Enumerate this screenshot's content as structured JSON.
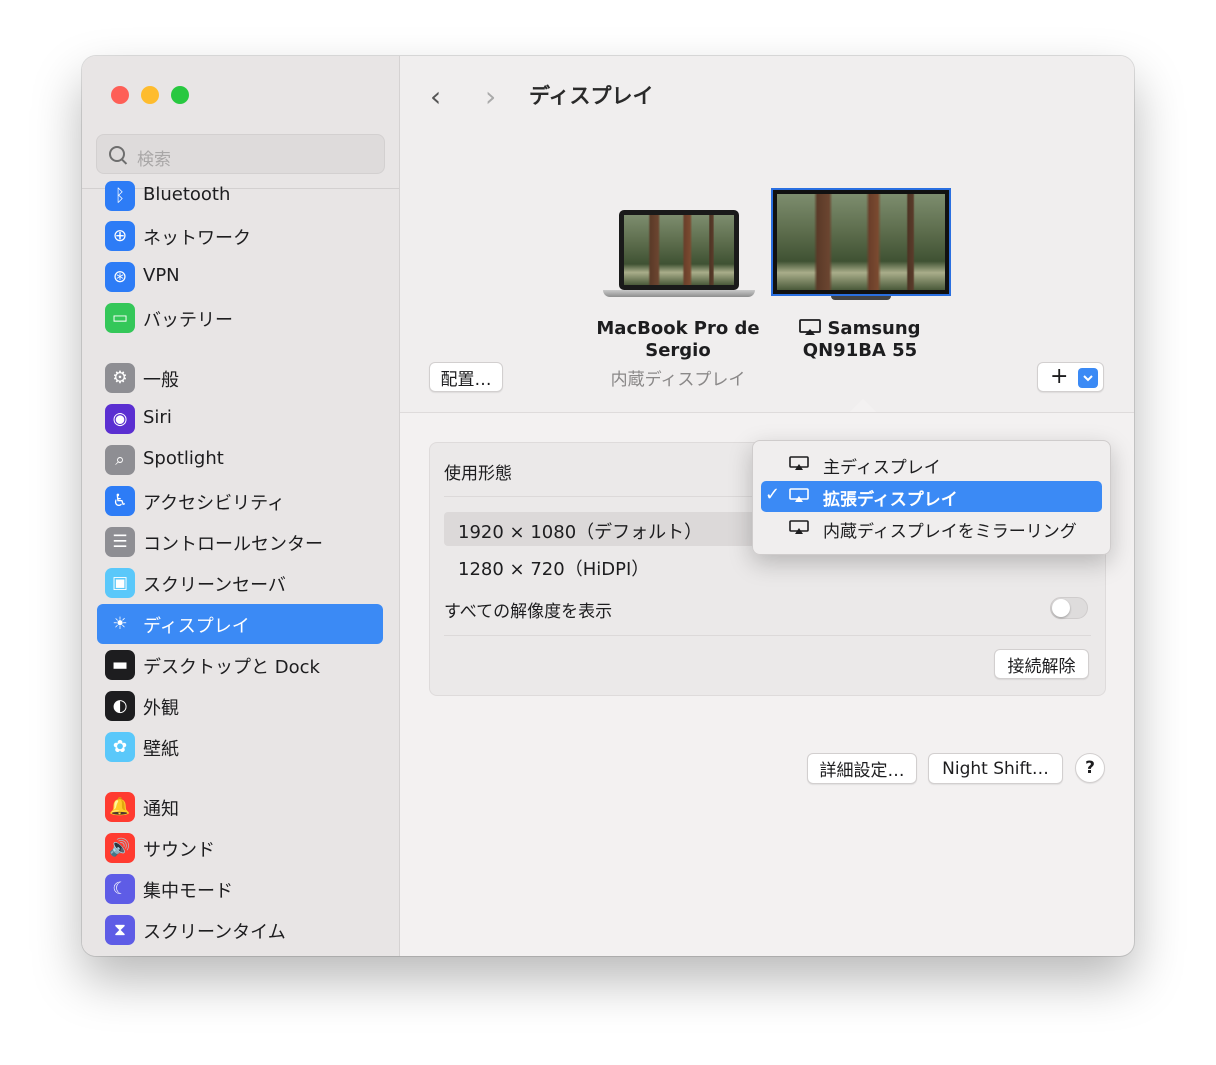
{
  "window": {
    "traffic_lights": [
      {
        "name": "close",
        "color": "#fe5f57"
      },
      {
        "name": "minimize",
        "color": "#febc2e"
      },
      {
        "name": "zoom",
        "color": "#28c840"
      }
    ]
  },
  "sidebar": {
    "search_placeholder": "検索",
    "items": [
      {
        "label": "Bluetooth",
        "icon": "bluetooth-icon",
        "color": "#2d7cf6",
        "glyph": "ᛒ"
      },
      {
        "label": "ネットワーク",
        "icon": "globe-icon",
        "color": "#2d7cf6",
        "glyph": "⊕"
      },
      {
        "label": "VPN",
        "icon": "vpn-globe-icon",
        "color": "#2d7cf6",
        "glyph": "⊛"
      },
      {
        "label": "バッテリー",
        "icon": "battery-icon",
        "color": "#34c759",
        "glyph": "▭"
      },
      {
        "label": "一般",
        "icon": "gear-icon",
        "color": "#8e8e93",
        "glyph": "⚙"
      },
      {
        "label": "Siri",
        "icon": "siri-icon",
        "color": "#5b2fd1",
        "glyph": "◉"
      },
      {
        "label": "Spotlight",
        "icon": "spotlight-icon",
        "color": "#8e8e93",
        "glyph": "⌕"
      },
      {
        "label": "アクセシビリティ",
        "icon": "accessibility-icon",
        "color": "#2d7cf6",
        "glyph": "♿"
      },
      {
        "label": "コントロールセンター",
        "icon": "control-center-icon",
        "color": "#8e8e93",
        "glyph": "☰"
      },
      {
        "label": "スクリーンセーバ",
        "icon": "screensaver-icon",
        "color": "#5ac8fa",
        "glyph": "▣"
      },
      {
        "label": "ディスプレイ",
        "icon": "display-sun-icon",
        "color": "#3b8af5",
        "glyph": "☀",
        "active": true
      },
      {
        "label": "デスクトップと Dock",
        "icon": "dock-icon",
        "color": "#1d1d1f",
        "glyph": "▬"
      },
      {
        "label": "外観",
        "icon": "appearance-icon",
        "color": "#1d1d1f",
        "glyph": "◐"
      },
      {
        "label": "壁紙",
        "icon": "wallpaper-flower-icon",
        "color": "#5ac8fa",
        "glyph": "✿"
      },
      {
        "label": "通知",
        "icon": "bell-icon",
        "color": "#ff3b30",
        "glyph": "🔔"
      },
      {
        "label": "サウンド",
        "icon": "speaker-icon",
        "color": "#ff3b30",
        "glyph": "🔊"
      },
      {
        "label": "集中モード",
        "icon": "moon-icon",
        "color": "#5e5ce6",
        "glyph": "☾"
      },
      {
        "label": "スクリーンタイム",
        "icon": "hourglass-icon",
        "color": "#5e5ce6",
        "glyph": "⧗"
      }
    ]
  },
  "header": {
    "back": "‹",
    "forward": "›",
    "title": "ディスプレイ"
  },
  "displays": {
    "arrange_button": "配置…",
    "macbook": {
      "name_line1": "MacBook Pro de",
      "name_line2": "Sergio",
      "subtitle": "内蔵ディスプレイ"
    },
    "samsung": {
      "name_line1": "Samsung",
      "name_line2": "QN91BA 55"
    },
    "add_button": "+"
  },
  "settings": {
    "usage_label": "使用形態",
    "resolutions": [
      "1920 × 1080（デフォルト）",
      "1280 × 720（HiDPI）"
    ],
    "show_all_label": "すべての解像度を表示",
    "show_all_enabled": false,
    "disconnect_button": "接続解除"
  },
  "usage_menu": {
    "options": [
      {
        "label": "主ディスプレイ",
        "selected": false
      },
      {
        "label": "拡張ディスプレイ",
        "selected": true
      },
      {
        "label": "内蔵ディスプレイをミラーリング",
        "selected": false
      }
    ],
    "check": "✓"
  },
  "footer": {
    "advanced_button": "詳細設定…",
    "night_shift_button": "Night Shift…",
    "help_button": "?"
  }
}
